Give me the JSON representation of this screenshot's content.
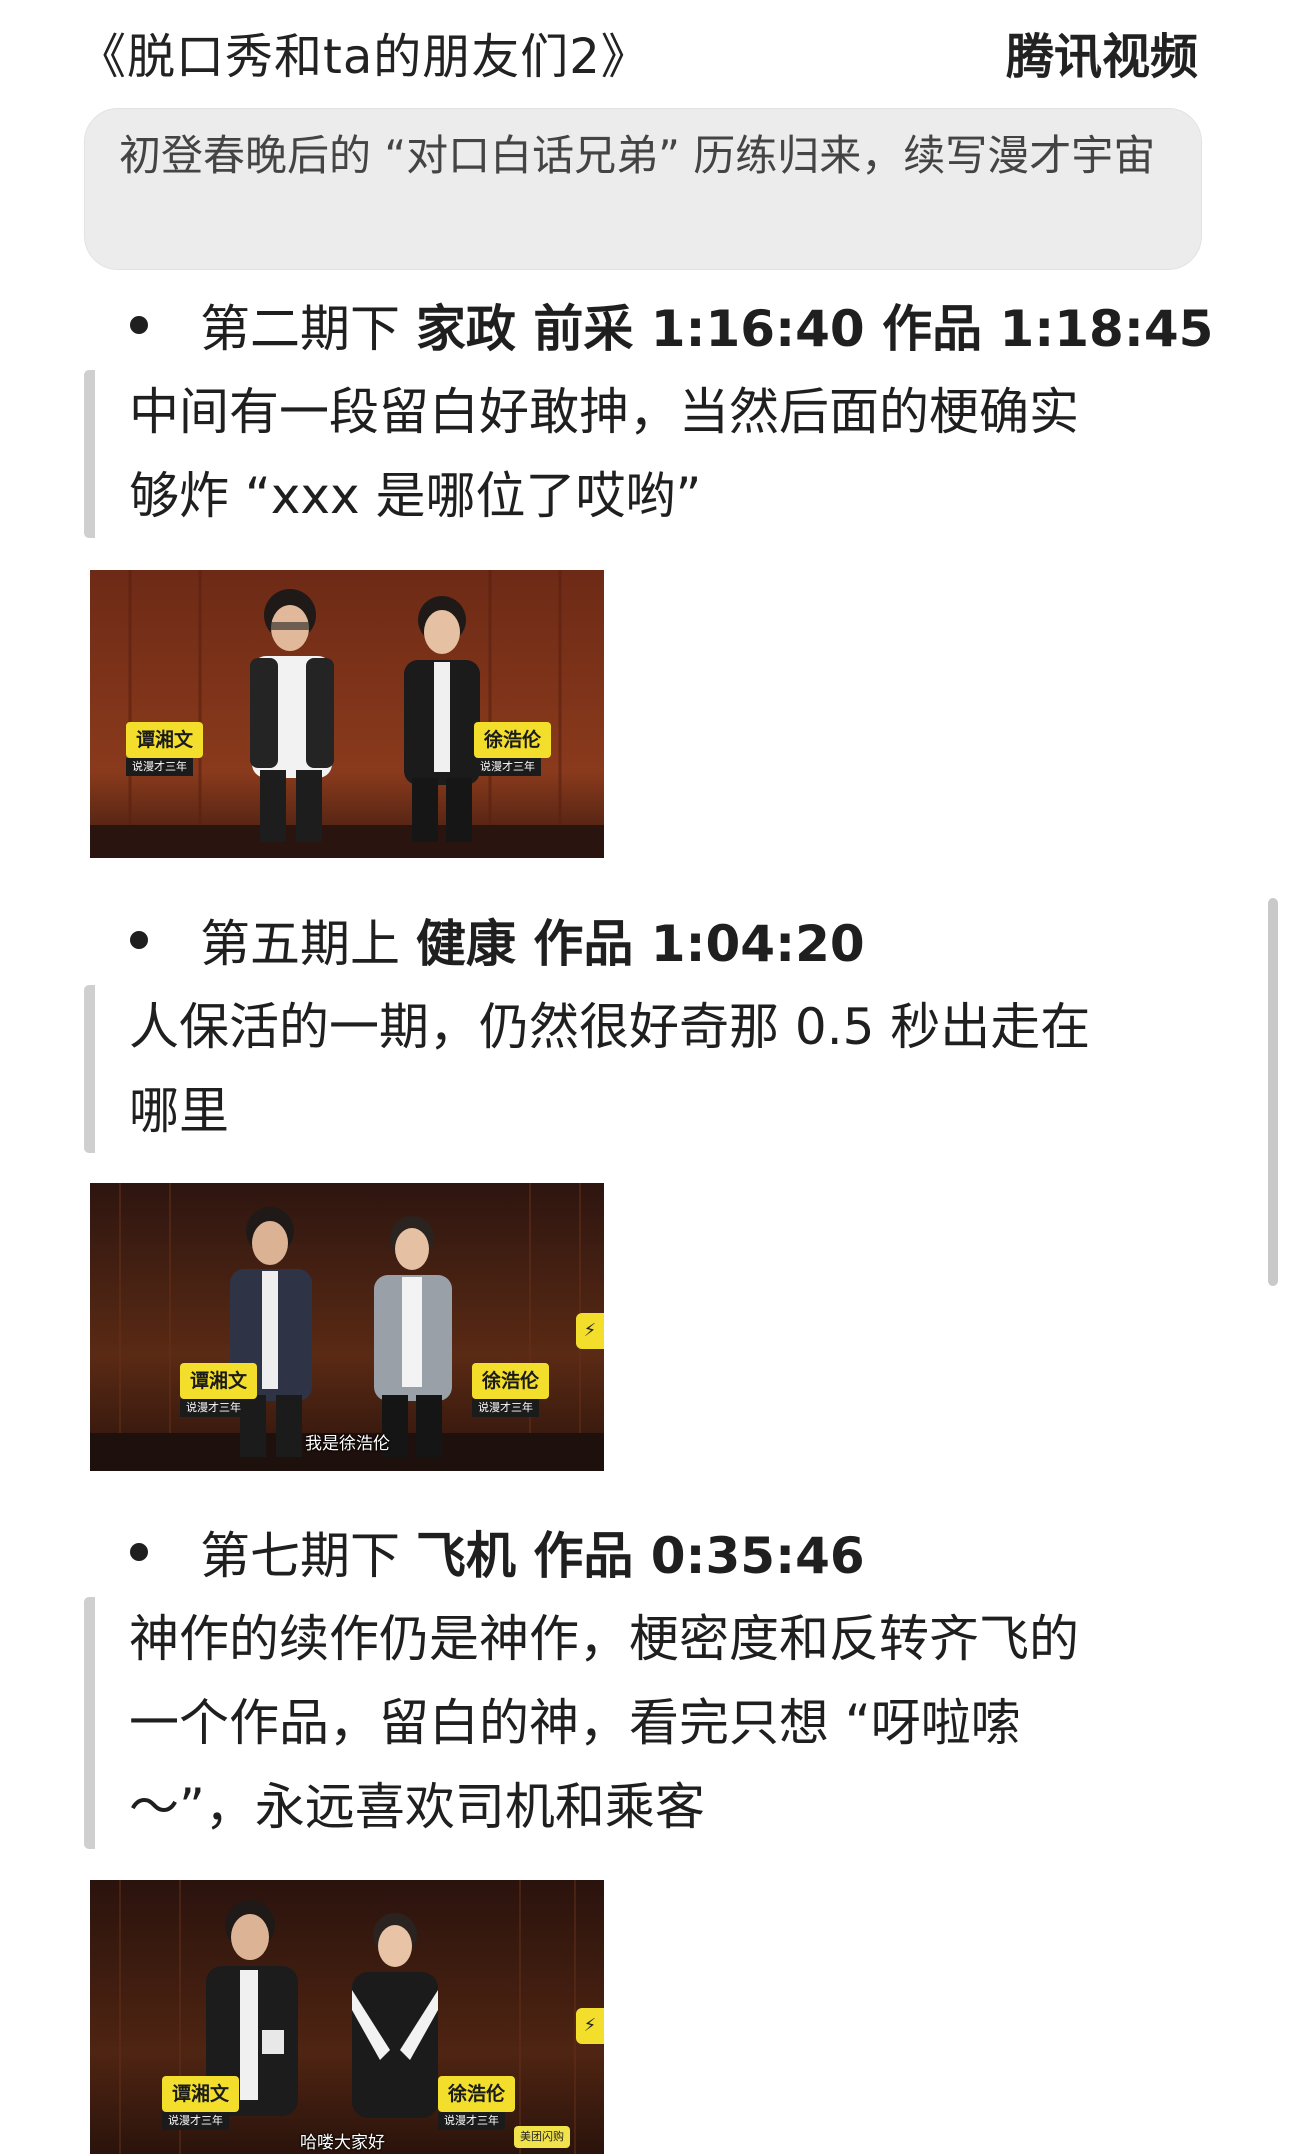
{
  "header": {
    "title": "《脱口秀和ta的朋友们2》",
    "source": "腾讯视频"
  },
  "summary": "初登春晚后的 “对口白话兄弟” 历练归来，续写漫才宇宙",
  "entries": [
    {
      "episode": "第二期下",
      "theme": "家政 前采 1:16:40 作品 1:18:45",
      "comment_lines": [
        "中间有一段留白好敢抻，当然后面的梗确实",
        "够炸 “xxx 是哪位了哎哟”"
      ],
      "image": {
        "left_name": "谭湘文",
        "left_sub": "说漫才三年",
        "right_name": "徐浩伦",
        "right_sub": "说漫才三年",
        "caption": ""
      }
    },
    {
      "episode": "第五期上",
      "theme": "健康 作品 1:04:20",
      "comment_lines": [
        "人保活的一期，仍然很好奇那 0.5 秒出走在",
        "哪里"
      ],
      "image": {
        "left_name": "谭湘文",
        "left_sub": "说漫才三年",
        "right_name": "徐浩伦",
        "right_sub": "说漫才三年",
        "caption": "我是徐浩伦"
      }
    },
    {
      "episode": "第七期下",
      "theme": "飞机 作品 0:35:46",
      "comment_lines": [
        "神作的续作仍是神作，梗密度和反转齐飞的",
        "一个作品，留白的神，看完只想 “呀啦嗦",
        "～”，永远喜欢司机和乘客"
      ],
      "image": {
        "left_name": "谭湘文",
        "left_sub": "说漫才三年",
        "right_name": "徐浩伦",
        "right_sub": "说漫才三年",
        "caption": "哈喽大家好",
        "sponsor": "美团闪购"
      }
    }
  ],
  "colors": {
    "summary_bg": "#ececec",
    "quote_bar": "#cfcfcf",
    "nameplate": "#f3df2b"
  }
}
